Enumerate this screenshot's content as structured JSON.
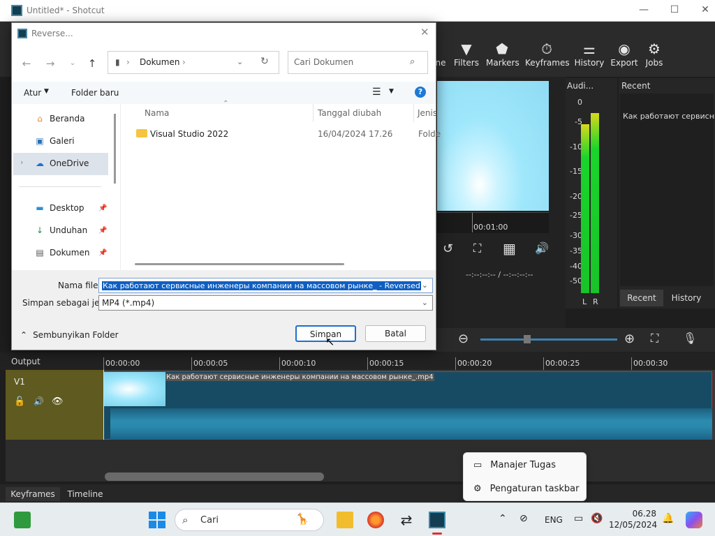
{
  "window": {
    "title": "Untitled* - Shotcut"
  },
  "toolbar": {
    "items": [
      {
        "label": "ne"
      },
      {
        "label": "Filters"
      },
      {
        "label": "Markers"
      },
      {
        "label": "Keyframes"
      },
      {
        "label": "History"
      },
      {
        "label": "Export"
      },
      {
        "label": "Jobs"
      }
    ]
  },
  "player": {
    "timecode_mark": "00:01:00",
    "timecode_display": "--:--:--:-- / --:--:--:--"
  },
  "audio_panel": {
    "title": "Audi...",
    "db_labels": [
      "0",
      "-5",
      "-10",
      "-15",
      "-20",
      "-25",
      "-30",
      "-35",
      "-40",
      "-50"
    ],
    "channels": [
      "L",
      "R"
    ]
  },
  "recent_panel": {
    "title": "Recent",
    "item": "Как работают сервисные",
    "tabs": [
      "Recent",
      "History"
    ]
  },
  "timeline": {
    "output_label": "Output",
    "track_name": "V1",
    "ruler": [
      "00:00:00",
      "00:00:05",
      "00:00:10",
      "00:00:15",
      "00:00:20",
      "00:00:25",
      "00:00:30"
    ],
    "clip_label": "Как работают сервисные инженеры компании на массовом рынке_.mp4",
    "bottom_tabs": [
      "Keyframes",
      "Timeline"
    ]
  },
  "dialog": {
    "title": "Reverse...",
    "path_folder": "Dokumen",
    "search_placeholder": "Cari Dokumen",
    "organize": "Atur",
    "new_folder": "Folder baru",
    "sidebar": [
      {
        "label": "Beranda"
      },
      {
        "label": "Galeri"
      },
      {
        "label": "OneDrive"
      },
      {
        "label": "Desktop"
      },
      {
        "label": "Unduhan"
      },
      {
        "label": "Dokumen"
      }
    ],
    "columns": {
      "name": "Nama",
      "date": "Tanggal diubah",
      "type": "Jenis"
    },
    "files": [
      {
        "name": "Visual Studio 2022",
        "date": "16/04/2024 17.26",
        "type": "Folde"
      }
    ],
    "filename_label": "Nama file:",
    "filename_value": "Как работают сервисные инженеры компании на массовом рынке_ - Reversed",
    "savetype_label": "Simpan sebagai je...",
    "savetype_value": "MP4 (*.mp4)",
    "hide_folders": "Sembunyikan Folder",
    "save_button": "Simpan",
    "cancel_button": "Batal"
  },
  "context_menu": {
    "items": [
      {
        "label": "Manajer Tugas"
      },
      {
        "label": "Pengaturan taskbar"
      }
    ]
  },
  "taskbar": {
    "search_placeholder": "Cari",
    "language": "ENG",
    "time": "06.28",
    "date": "12/05/2024"
  }
}
